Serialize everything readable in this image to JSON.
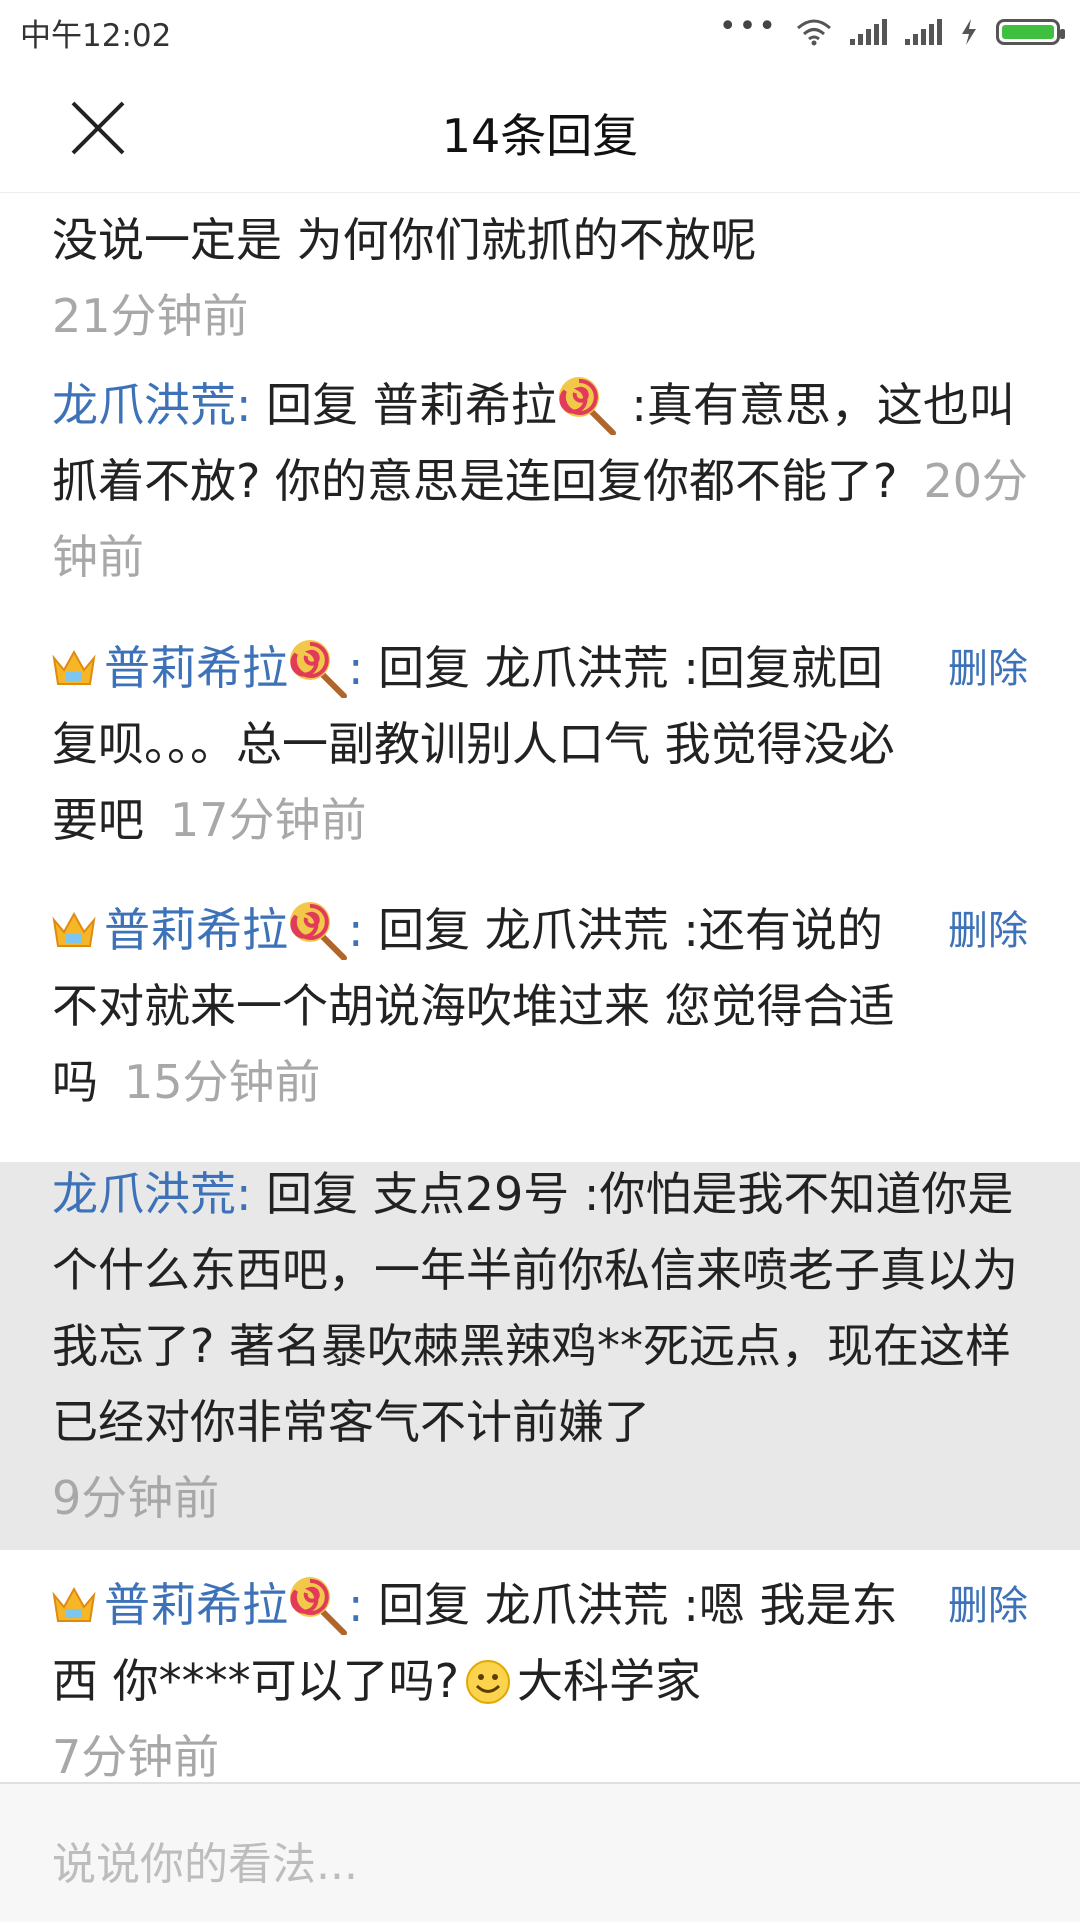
{
  "status": {
    "time": "中午12:02",
    "dots": "•••",
    "icons": [
      "wifi-icon",
      "signal-icon",
      "signal-icon",
      "charging-icon",
      "battery-icon"
    ],
    "battery_color": "#3fbf3f"
  },
  "nav": {
    "close_icon": "close-icon",
    "title": "14条回复"
  },
  "replies": [
    {
      "content": "没说一定是 为何你们就抓的不放呢",
      "time": "21分钟前"
    },
    {
      "author": "龙爪洪荒",
      "colon": ":",
      "prefix": " 回复 普莉希拉",
      "content": " :真有意思，这也叫抓着不放? 你的意思是连回复你都不能了?",
      "time": "20分钟前"
    },
    {
      "author": "普莉希拉",
      "colon": ":",
      "content": " 回复 龙爪洪荒 :回复就回复呗。。。总一副教训别人口气 我觉得没必要吧",
      "time": "17分钟前",
      "delete": "删除"
    },
    {
      "author": "普莉希拉",
      "colon": ":",
      "content": " 回复 龙爪洪荒 :还有说的不对就来一个胡说海吹堆过来 您觉得合适吗",
      "time": "15分钟前",
      "delete": "删除"
    },
    {
      "author": "龙爪洪荒",
      "colon": ":",
      "content": " 回复 支点29号 :你怕是我不知道你是个什么东西吧，一年半前你私信来喷老子真以为我忘了? 著名暴吹棘黑辣鸡**死远点，现在这样已经对你非常客气不计前嫌了",
      "time": "9分钟前",
      "highlight": true
    },
    {
      "author": "普莉希拉",
      "colon": ":",
      "content": " 回复 龙爪洪荒 :嗯 我是东西 你****可以了吗?",
      "suffix": "大科学家",
      "time": "7分钟前",
      "delete": "删除"
    }
  ],
  "input": {
    "placeholder": "说说你的看法..."
  },
  "colors": {
    "link_blue": "#3d72b8",
    "time_gray": "#a8a8a8",
    "highlight_bg": "#e8e8e8"
  }
}
